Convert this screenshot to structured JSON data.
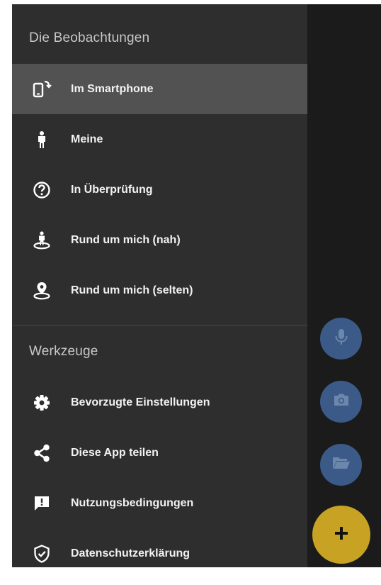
{
  "drawer": {
    "section_observations": "Die Beobachtungen",
    "observations": [
      {
        "label": "Im Smartphone",
        "icon": "phone-transfer-icon",
        "active": true
      },
      {
        "label": "Meine",
        "icon": "person-icon"
      },
      {
        "label": "In Überprüfung",
        "icon": "help-circle-icon"
      },
      {
        "label": "Rund um mich (nah)",
        "icon": "person-nearby-icon"
      },
      {
        "label": "Rund um mich (selten)",
        "icon": "location-pin-icon"
      }
    ],
    "section_tools": "Werkzeuge",
    "tools": [
      {
        "label": "Bevorzugte Einstellungen",
        "icon": "gear-icon"
      },
      {
        "label": "Diese App teilen",
        "icon": "share-icon"
      },
      {
        "label": "Nutzungsbedingungen",
        "icon": "feedback-icon"
      },
      {
        "label": "Datenschutzerklärung",
        "icon": "shield-check-icon"
      }
    ]
  },
  "fabs": {
    "mic": "microphone-icon",
    "camera": "camera-icon",
    "folder": "folder-open-icon",
    "add": "plus-icon"
  },
  "colors": {
    "drawer_bg": "#2e2e2e",
    "active_item_bg": "#525252",
    "fab_small": "#3b5a88",
    "fab_add": "#c8a222",
    "text": "#f2f2f2"
  }
}
